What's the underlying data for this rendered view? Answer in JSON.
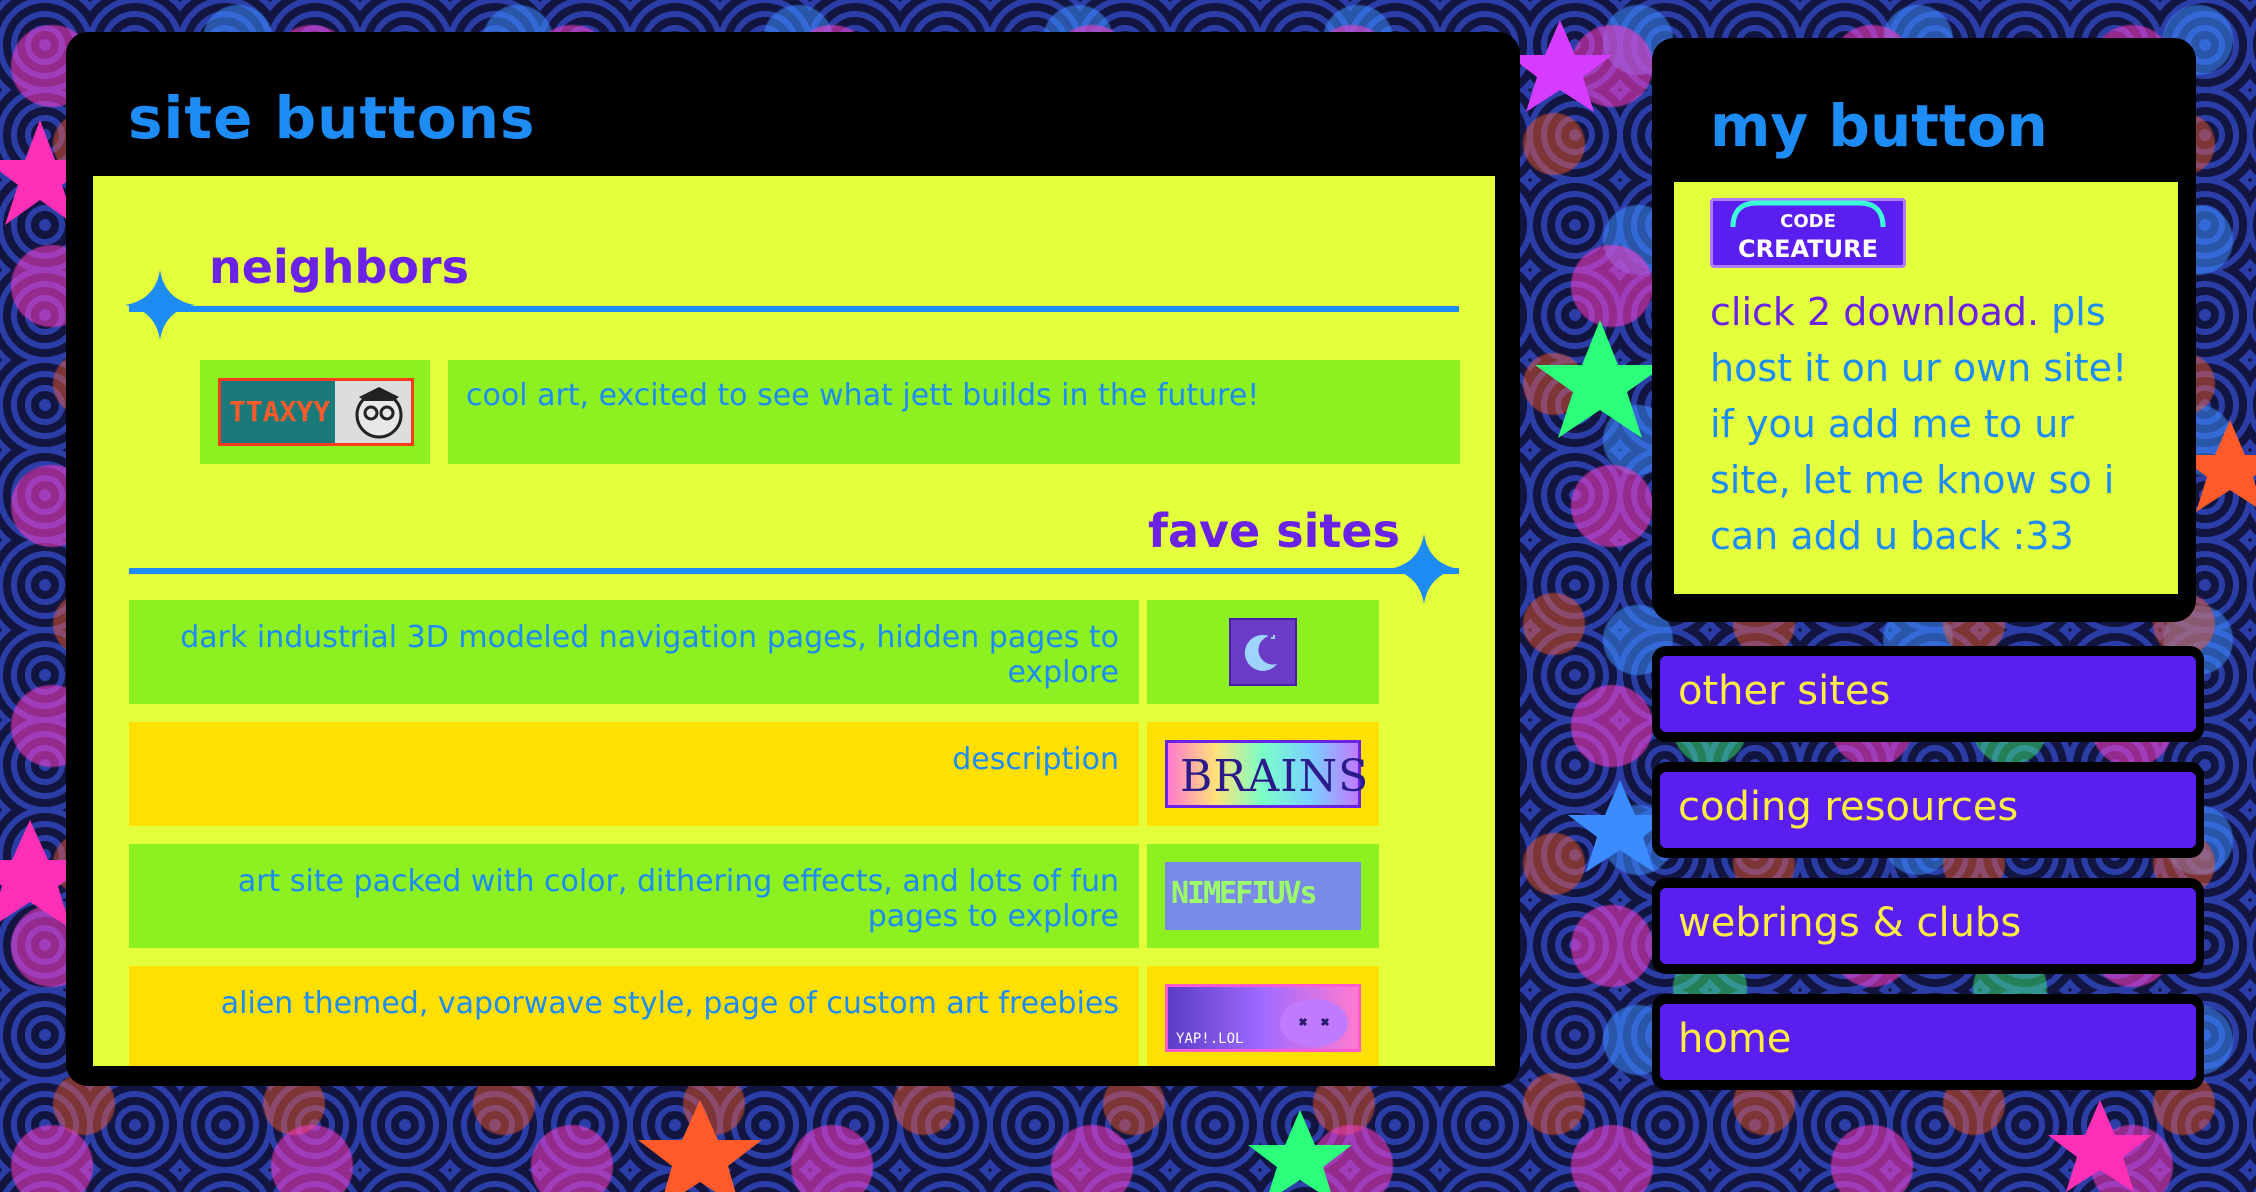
{
  "main": {
    "title": "site buttons",
    "neighbors": {
      "heading": "neighbors",
      "items": [
        {
          "button_text": "TTAXYY",
          "description": "cool art, excited to see what jett builds in the future!"
        }
      ]
    },
    "fave_sites": {
      "heading": "fave sites",
      "items": [
        {
          "description": "dark industrial 3D modeled navigation pages, hidden pages to explore",
          "button_icon": "moon-icon"
        },
        {
          "description": "description",
          "button_text": "BRAINS"
        },
        {
          "description": "art site packed with color, dithering effects, and lots of fun pages to explore",
          "button_text": "NIMEFIUVs"
        },
        {
          "description": "alien themed, vaporwave style, page of custom art freebies",
          "button_text": "YAP!.LOL"
        }
      ]
    }
  },
  "side": {
    "title": "my button",
    "button_line1": "CODE",
    "button_line2": "CREATURE",
    "text_highlight": "click 2 download.",
    "text_rest": " pls host it on ur own site! if you add me to ur site, let me know so i can add u back :33"
  },
  "nav": [
    {
      "label": "other sites"
    },
    {
      "label": "coding resources"
    },
    {
      "label": "webrings & clubs"
    },
    {
      "label": "home"
    }
  ],
  "colors": {
    "panel_bg": "#000000",
    "content_bg": "#e4ff3c",
    "title_blue": "#1e8cf5",
    "heading_purple": "#6a22e6",
    "row_green": "#8cf021",
    "row_yellow": "#ffe000",
    "nav_purple": "#5a1ef0",
    "nav_text": "#ffee40"
  }
}
